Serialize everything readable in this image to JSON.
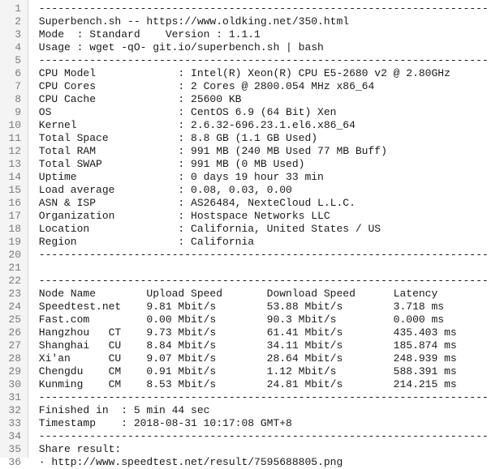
{
  "lines": [
    " -----------------------------------------------------------------------",
    " Superbench.sh -- https://www.oldking.net/350.html",
    " Mode  : Standard    Version : 1.1.1",
    " Usage : wget -qO- git.io/superbench.sh | bash",
    " -----------------------------------------------------------------------",
    " CPU Model             : Intel(R) Xeon(R) CPU E5-2680 v2 @ 2.80GHz",
    " CPU Cores             : 2 Cores @ 2800.054 MHz x86_64",
    " CPU Cache             : 25600 KB",
    " OS                    : CentOS 6.9 (64 Bit) Xen",
    " Kernel                : 2.6.32-696.23.1.el6.x86_64",
    " Total Space           : 8.8 GB (1.1 GB Used)",
    " Total RAM             : 991 MB (240 MB Used 77 MB Buff)",
    " Total SWAP            : 991 MB (0 MB Used)",
    " Uptime                : 0 days 19 hour 33 min",
    " Load average          : 0.08, 0.03, 0.00",
    " ASN & ISP             : AS26484, NexteCloud L.L.C.",
    " Organization          : Hostspace Networks LLC",
    " Location              : California, United States / US",
    " Region                : California",
    " -----------------------------------------------------------------------",
    "",
    " -----------------------------------------------------------------------",
    " Node Name        Upload Speed       Download Speed      Latency",
    " Speedtest.net    9.81 Mbit/s        53.88 Mbit/s        3.718 ms",
    " Fast.com         0.00 Mbit/s        90.3 Mbit/s         0.000 ms",
    " Hangzhou   CT    9.73 Mbit/s        61.41 Mbit/s        435.403 ms",
    " Shanghai   CU    8.84 Mbit/s        34.11 Mbit/s        185.874 ms",
    " Xi'an      CU    9.07 Mbit/s        28.64 Mbit/s        248.939 ms",
    " Chengdu    CM    0.91 Mbit/s        1.12 Mbit/s         588.391 ms",
    " Kunming    CM    8.53 Mbit/s        24.81 Mbit/s        214.215 ms",
    " -----------------------------------------------------------------------",
    " Finished in  : 5 min 44 sec",
    " Timestamp    : 2018-08-31 10:17:08 GMT+8",
    " -----------------------------------------------------------------------",
    " Share result:",
    " · http://www.speedtest.net/result/7595688805.png"
  ]
}
